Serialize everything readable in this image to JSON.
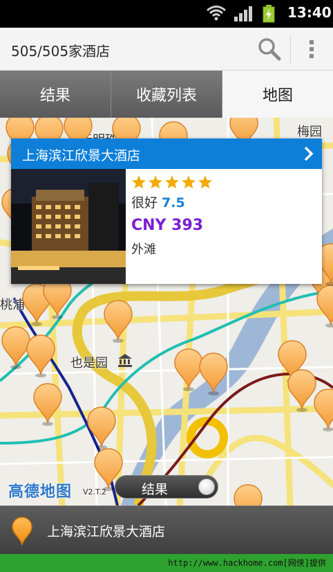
{
  "status_bar": {
    "time": "13:40",
    "wifi_icon": "wifi-icon",
    "signal_icon": "signal-icon",
    "battery_icon": "battery-charging-icon"
  },
  "action_bar": {
    "title": "505/505家酒店",
    "search_icon": "search-icon",
    "menu_icon": "overflow-menu-icon"
  },
  "tabs": [
    {
      "label": "结果",
      "active": false
    },
    {
      "label": "收藏列表",
      "active": false
    },
    {
      "label": "地图",
      "active": true
    }
  ],
  "map": {
    "labels": {
      "meiyuan": "梅园新",
      "yuanming": "元明珠",
      "taopu": "桃浦",
      "yeshiyuan": "也是园"
    },
    "logo_text": "高德地图",
    "version": "V2.T.2"
  },
  "popup": {
    "hotel_name": "上海滨江欣景大酒店",
    "stars": 5,
    "rating_text": "很好",
    "rating_score": "7.5",
    "price": "CNY 393",
    "district": "外滩",
    "colors": {
      "header": "#0e7fd9",
      "price": "#7a1fd2",
      "score": "#1a7fd6",
      "star": "#f2a900"
    }
  },
  "toggle": {
    "label": "结果"
  },
  "bottom_bar": {
    "hotel_name": "上海滨江欣景大酒店"
  },
  "watermark": {
    "text": "http://www.hackhome.com[网侠]提供"
  }
}
